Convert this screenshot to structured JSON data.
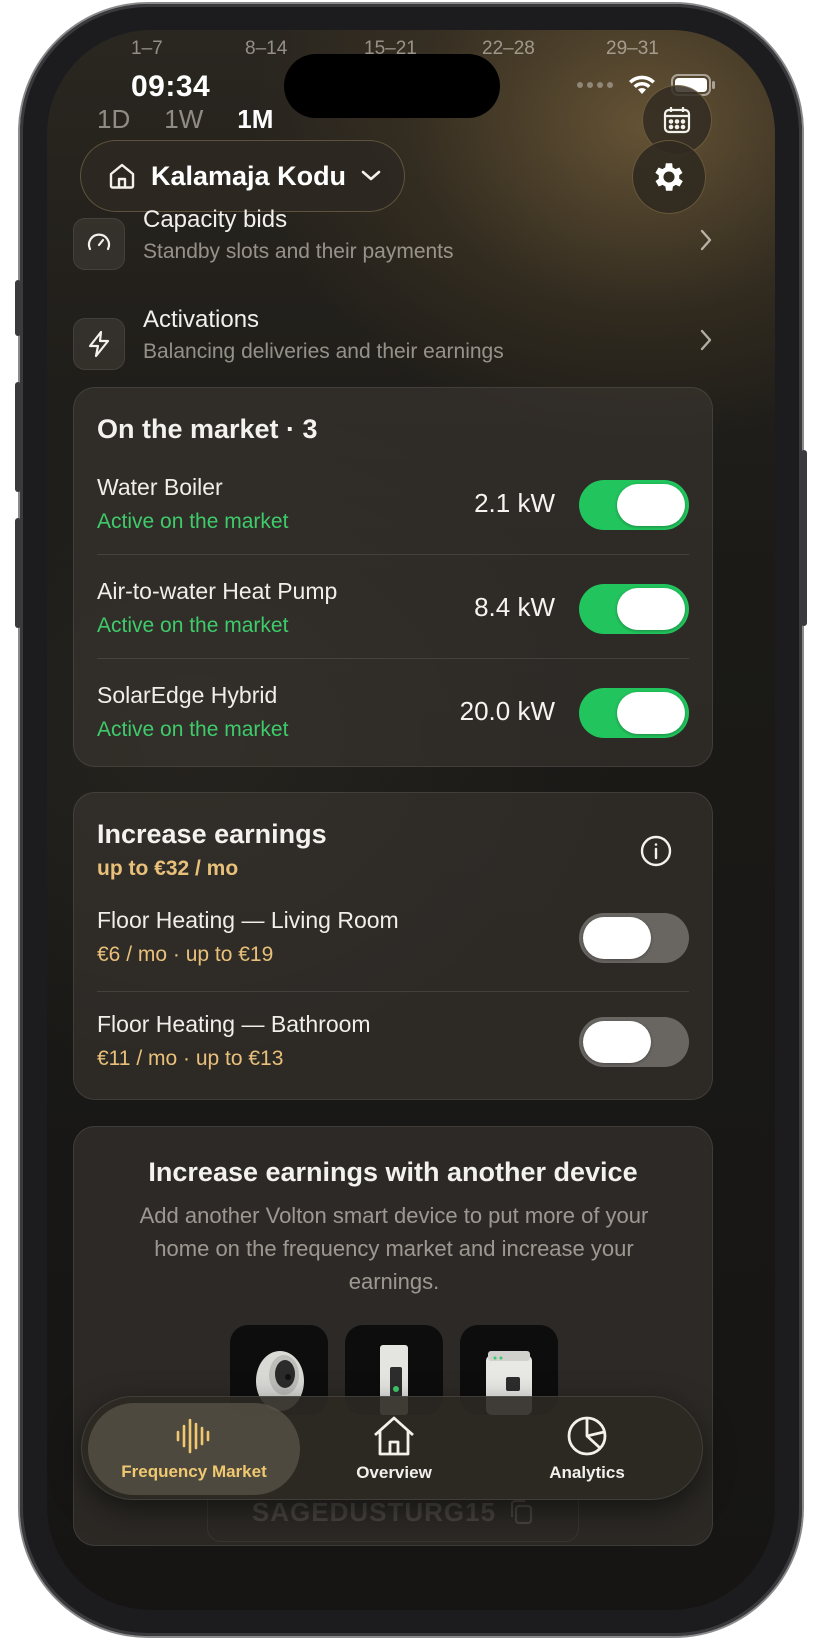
{
  "status_bar": {
    "time": "09:34"
  },
  "week_labels": [
    "1–7",
    "8–14",
    "15–21",
    "22–28",
    "29–31"
  ],
  "range_tabs": [
    {
      "label": "1D",
      "active": false
    },
    {
      "label": "1W",
      "active": false
    },
    {
      "label": "1M",
      "active": true
    }
  ],
  "home_selector": {
    "label": "Kalamaja Kodu",
    "icon": "house-icon"
  },
  "nav_rows": [
    {
      "title": "Capacity bids",
      "subtitle": "Standby slots and their payments",
      "icon": "gauge-icon"
    },
    {
      "title": "Activations",
      "subtitle": "Balancing deliveries and their earnings",
      "icon": "lightning-icon"
    }
  ],
  "market_card": {
    "title": "On the market · 3",
    "devices": [
      {
        "name": "Water Boiler",
        "status": "Active on the market",
        "power": "2.1 kW",
        "enabled": true
      },
      {
        "name": "Air-to-water Heat Pump",
        "status": "Active on the market",
        "power": "8.4 kW",
        "enabled": true
      },
      {
        "name": "SolarEdge Hybrid",
        "status": "Active on the market",
        "power": "20.0 kW",
        "enabled": true
      }
    ]
  },
  "earnings_card": {
    "title": "Increase earnings",
    "upto": "up to €32 / mo",
    "devices": [
      {
        "name": "Floor Heating — Living Room",
        "price": "€6 / mo · up to €19",
        "enabled": false
      },
      {
        "name": "Floor Heating — Bathroom",
        "price": "€11 / mo · up to €13",
        "enabled": false
      }
    ]
  },
  "promo_card": {
    "title": "Increase earnings with another device",
    "body": "Add another Volton smart device to put more of your home on the frequency market and increase your earnings.",
    "thumbnails": [
      "smart-plug",
      "din-rail-meter",
      "relay-module"
    ]
  },
  "ghost_code": "SAGEDUSTURG15",
  "tab_bar": [
    {
      "label": "Frequency Market",
      "icon": "waveform-icon",
      "active": true
    },
    {
      "label": "Overview",
      "icon": "house-icon",
      "active": false
    },
    {
      "label": "Analytics",
      "icon": "pie-chart-icon",
      "active": false
    }
  ],
  "colors": {
    "accent_green": "#22c45e",
    "status_green": "#3ecb6b",
    "gold": "#e8c07a",
    "tab_active_gold": "#f0c870"
  }
}
